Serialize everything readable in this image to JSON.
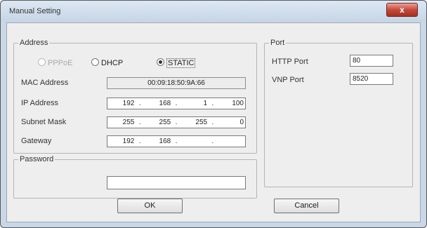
{
  "window": {
    "title": "Manual Setting",
    "close_label": "x"
  },
  "address_group": {
    "legend": "Address",
    "radios": [
      {
        "label": "PPPoE",
        "checked": false,
        "disabled": true
      },
      {
        "label": "DHCP",
        "checked": false,
        "disabled": false
      },
      {
        "label": "STATIC",
        "checked": true,
        "disabled": false
      }
    ],
    "mac_label": "MAC Address",
    "mac_value": "00:09:18:50:9A:66",
    "ip_label": "IP Address",
    "ip": [
      "192",
      "168",
      "1",
      "100"
    ],
    "subnet_label": "Subnet Mask",
    "subnet": [
      "255",
      "255",
      "255",
      "0"
    ],
    "gateway_label": "Gateway",
    "gateway": [
      "192",
      "168",
      "",
      ""
    ]
  },
  "port_group": {
    "legend": "Port",
    "http_label": "HTTP Port",
    "http_value": "80",
    "vnp_label": "VNP Port",
    "vnp_value": "8520"
  },
  "password_group": {
    "legend": "Password",
    "value": ""
  },
  "buttons": {
    "ok": "OK",
    "cancel": "Cancel"
  }
}
